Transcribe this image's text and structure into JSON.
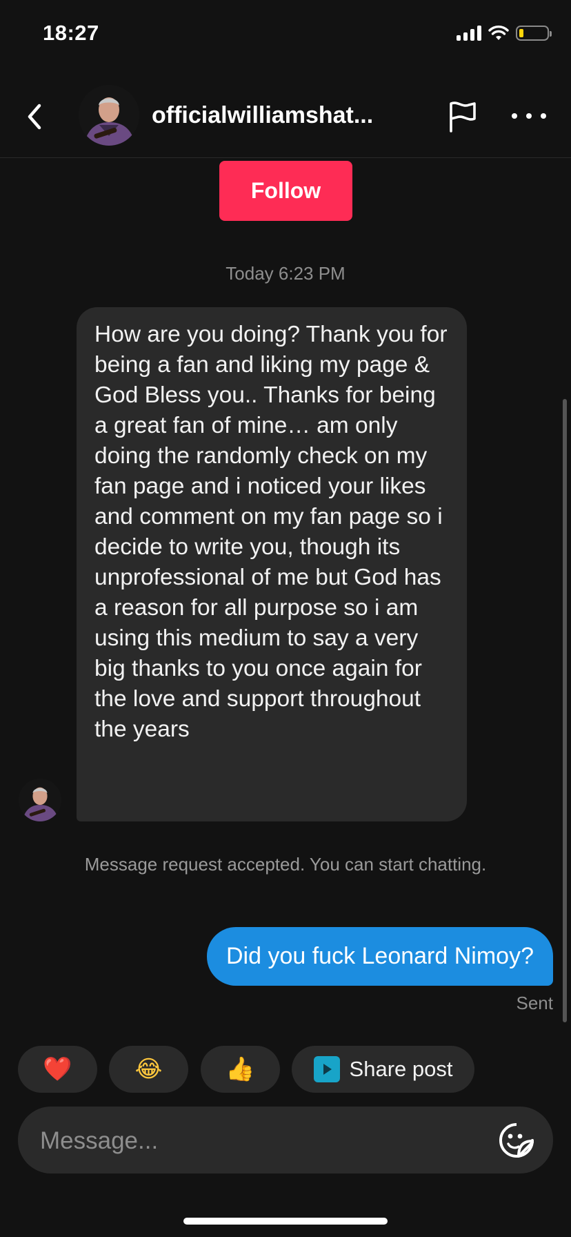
{
  "status_bar": {
    "time": "18:27"
  },
  "header": {
    "username": "officialwilliamshat..."
  },
  "follow_button": {
    "label": "Follow"
  },
  "conversation": {
    "timestamp": "Today 6:23 PM",
    "received_message": "How are you doing? Thank you for being a fan and liking my page & God Bless you.. Thanks for being a great fan of mine… am only doing the randomly check on my fan page and i noticed your likes and comment on my fan page so i decide to write you, though its unprofessional of me but God has a reason for all purpose so i am using this medium to say a very big thanks to you once again for the love and support throughout the years",
    "system_note": "Message request accepted. You can start chatting.",
    "sent_message": "Did you fuck Leonard Nimoy?",
    "sent_status": "Sent"
  },
  "quick_replies": {
    "heart": "❤️",
    "laugh": "😂",
    "thumbs_up": "👍",
    "share_post_label": "Share post"
  },
  "message_input": {
    "placeholder": "Message..."
  },
  "icons": {
    "back": "chevron-left-icon",
    "flag": "flag-icon",
    "more": "more-horizontal-icon",
    "share": "play-square-icon",
    "sticker": "sticker-icon"
  },
  "colors": {
    "background": "#121212",
    "follow": "#fe2c55",
    "sent_bubble": "#1c8de0",
    "received_bubble": "#2a2a2a",
    "battery_low": "#ffd60a"
  }
}
